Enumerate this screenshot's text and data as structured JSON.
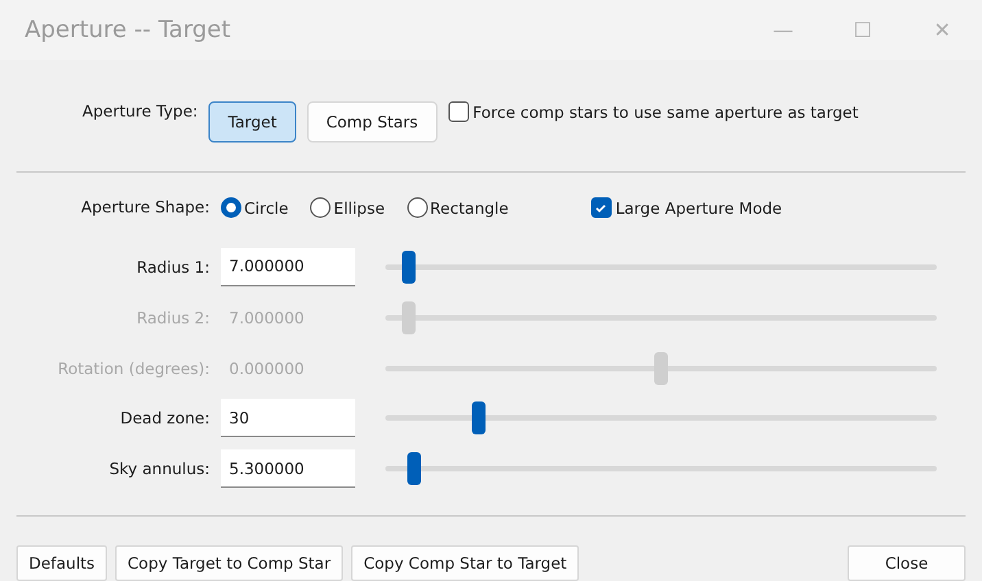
{
  "window": {
    "title": "Aperture -- Target",
    "controls": [
      "—",
      "☐",
      "✕"
    ]
  },
  "aperture_type": {
    "label": "Aperture Type:",
    "options": [
      {
        "label": "Target",
        "selected": true
      },
      {
        "label": "Comp Stars",
        "selected": false
      }
    ],
    "force_checkbox": {
      "label": "Force comp stars to use same aperture as target",
      "checked": false
    }
  },
  "aperture_shape": {
    "label": "Aperture Shape:",
    "options": [
      {
        "label": "Circle",
        "selected": true
      },
      {
        "label": "Ellipse",
        "selected": false
      },
      {
        "label": "Rectangle",
        "selected": false
      }
    ],
    "large_mode": {
      "label": "Large Aperture Mode",
      "checked": true
    }
  },
  "rows": [
    {
      "label": "Radius 1:",
      "value": "7.000000",
      "disabled": false,
      "level": 0.03
    },
    {
      "label": "Radius 2:",
      "value": "7.000000",
      "disabled": true,
      "level": 0.03
    },
    {
      "label": "Rotation (degrees):",
      "value": "0.000000",
      "disabled": true,
      "level": 0.5
    },
    {
      "label": "Dead zone:",
      "value": "30",
      "disabled": false,
      "level": 0.16
    },
    {
      "label": "Sky annulus:",
      "value": "5.300000",
      "disabled": false,
      "level": 0.04
    }
  ],
  "buttons": [
    "Defaults",
    "Copy Target to Comp Star",
    "Copy Comp Star to Target"
  ],
  "close_button": "Close"
}
